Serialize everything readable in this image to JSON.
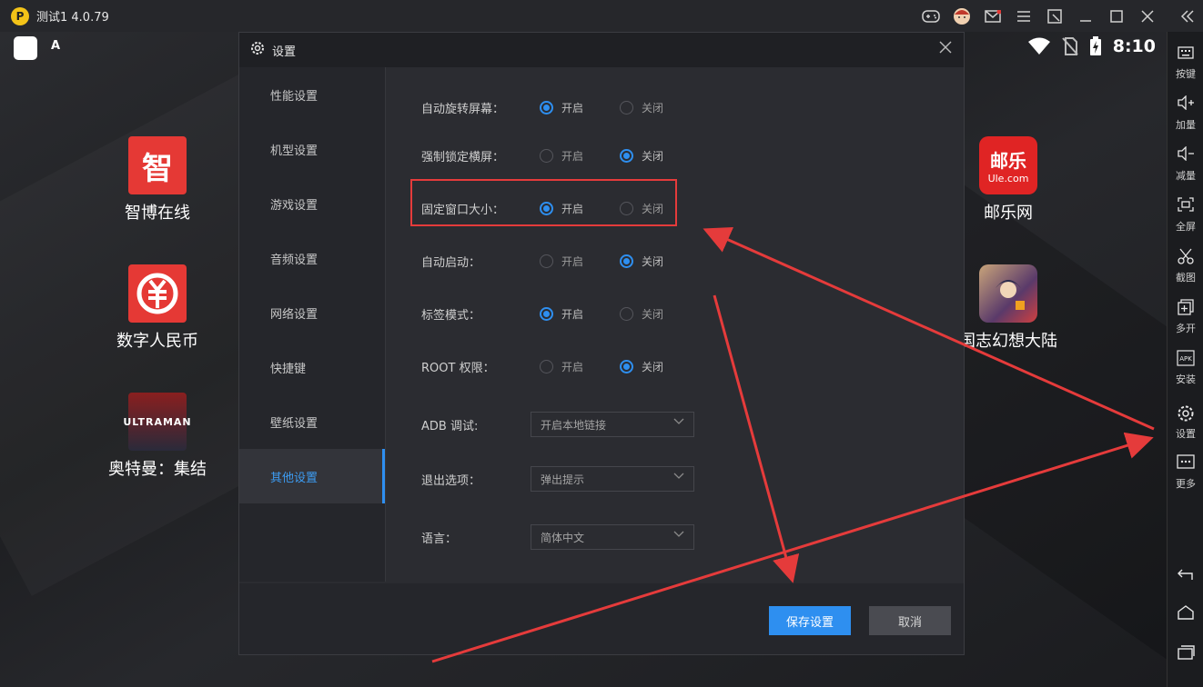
{
  "titlebar": {
    "logo_text": "P",
    "title": "测试1 4.0.79",
    "icons": [
      "gamepad-icon",
      "avatar-icon",
      "mail-icon",
      "menu-icon",
      "popout-icon",
      "minimize-icon",
      "maximize-icon",
      "close-icon",
      "collapse-icon"
    ]
  },
  "statusbar": {
    "time": "8:10",
    "a_label": "A"
  },
  "desktop_apps": [
    {
      "label": "智博在线",
      "icon_text": "智",
      "color": "#e53935"
    },
    {
      "label": "数字人民币",
      "icon_text": "¥",
      "color": "#e53935"
    },
    {
      "label": "奥特曼：集结",
      "icon_text": "ULTRAMAN",
      "color": "#7a2a2a"
    },
    {
      "label": "邮乐网",
      "icon_text": "邮乐",
      "sub_text": "Ule.com",
      "color": "#e02424"
    },
    {
      "label": "国志幻想大陆",
      "icon_text": "",
      "color": "#6a4a8a"
    }
  ],
  "sidebar": [
    {
      "label": "按键",
      "icon": "keyboard-icon"
    },
    {
      "label": "加量",
      "icon": "volume-up-icon"
    },
    {
      "label": "减量",
      "icon": "volume-down-icon"
    },
    {
      "label": "全屏",
      "icon": "fullscreen-icon"
    },
    {
      "label": "截图",
      "icon": "scissors-icon"
    },
    {
      "label": "多开",
      "icon": "multi-open-icon"
    },
    {
      "label": "安装",
      "icon": "apk-icon"
    },
    {
      "label": "设置",
      "icon": "gear-icon"
    },
    {
      "label": "更多",
      "icon": "more-icon"
    }
  ],
  "sidebar_bottom": [
    "back-icon",
    "home-icon",
    "recents-icon"
  ],
  "dialog": {
    "title": "设置",
    "nav": [
      "性能设置",
      "机型设置",
      "游戏设置",
      "音频设置",
      "网络设置",
      "快捷键",
      "壁纸设置",
      "其他设置"
    ],
    "active_nav": "其他设置",
    "radio_rows": [
      {
        "label": "自动旋转屏幕：",
        "on": "开启",
        "off": "关闭",
        "selected": "on"
      },
      {
        "label": "强制锁定横屏：",
        "on": "开启",
        "off": "关闭",
        "selected": "off"
      },
      {
        "label": "固定窗口大小：",
        "on": "开启",
        "off": "关闭",
        "selected": "on"
      },
      {
        "label": "自动启动：",
        "on": "开启",
        "off": "关闭",
        "selected": "off"
      },
      {
        "label": "标签模式：",
        "on": "开启",
        "off": "关闭",
        "selected": "on"
      },
      {
        "label": "ROOT 权限：",
        "on": "开启",
        "off": "关闭",
        "selected": "off"
      }
    ],
    "select_rows": [
      {
        "label": "ADB 调试:",
        "value": "开启本地链接"
      },
      {
        "label": "退出选项：",
        "value": "弹出提示"
      },
      {
        "label": "语言：",
        "value": "简体中文"
      }
    ],
    "save_label": "保存设置",
    "cancel_label": "取消"
  },
  "annotation_color": "#e53b3b"
}
